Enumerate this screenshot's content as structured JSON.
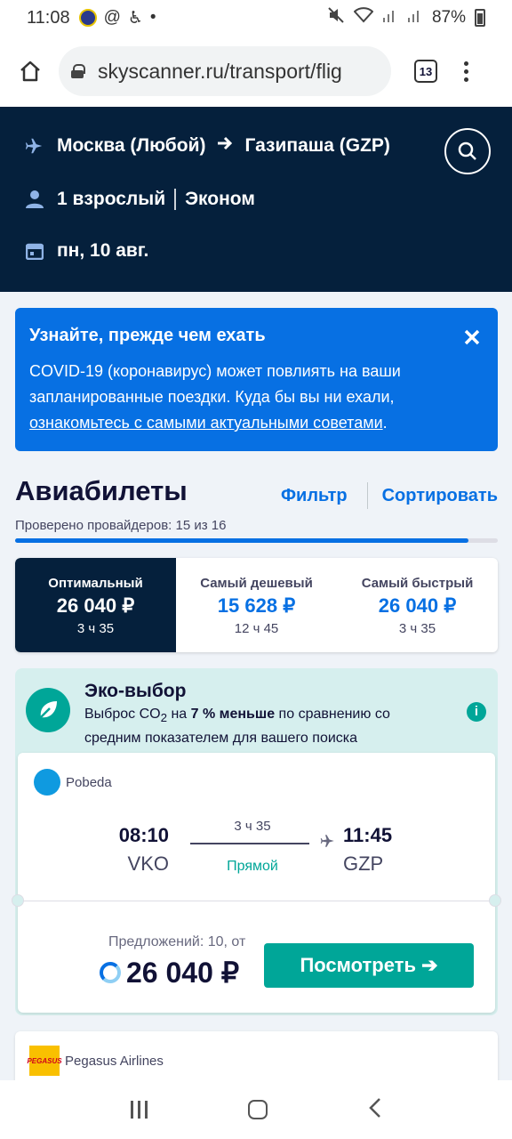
{
  "status_bar": {
    "time": "11:08",
    "battery": "87%"
  },
  "browser": {
    "url": "skyscanner.ru/transport/flig",
    "tab_count": "13"
  },
  "search": {
    "origin": "Москва (Любой)",
    "destination": "Газипаша (GZP)",
    "passengers": "1 взрослый",
    "cabin": "Эконом",
    "date": "пн, 10 авг."
  },
  "covid_banner": {
    "title": "Узнайте, прежде чем ехать",
    "text": "COVID-19 (коронавирус) может повлиять на ваши запланированные поездки. Куда бы вы ни ехали,",
    "link": "ознакомьтесь с самыми актуальными советами",
    "suffix": "."
  },
  "results": {
    "title": "Авиабилеты",
    "filter_label": "Фильтр",
    "sort_label": "Сортировать",
    "providers": "Проверено провайдеров: 15 из 16",
    "progress_fraction": 0.94
  },
  "sort_tabs": [
    {
      "label": "Оптимальный",
      "price": "26 040 ₽",
      "duration": "3 ч 35"
    },
    {
      "label": "Самый дешевый",
      "price": "15 628 ₽",
      "duration": "12 ч 45"
    },
    {
      "label": "Самый быстрый",
      "price": "26 040 ₽",
      "duration": "3 ч 35"
    }
  ],
  "eco": {
    "title": "Эко-выбор",
    "desc_pre": "Выброс CO",
    "desc_sub": "2",
    "desc_mid": " на ",
    "desc_bold": "7 % меньше",
    "desc_post": " по сравнению со средним показателем для вашего поиска"
  },
  "flight": {
    "airline": "Pobeda",
    "dep_time": "08:10",
    "dep_code": "VKO",
    "duration": "3 ч 35",
    "stops": "Прямой",
    "arr_time": "11:45",
    "arr_code": "GZP",
    "offers": "Предложений: 10, от",
    "price": "26 040 ₽",
    "button": "Посмотреть ➔"
  },
  "next_flight": {
    "airline": "Pegasus Airlines",
    "logo_text": "PEGASUS"
  },
  "colors": {
    "brand_blue": "#0770e3",
    "navy": "#05203c",
    "teal": "#00a698"
  }
}
